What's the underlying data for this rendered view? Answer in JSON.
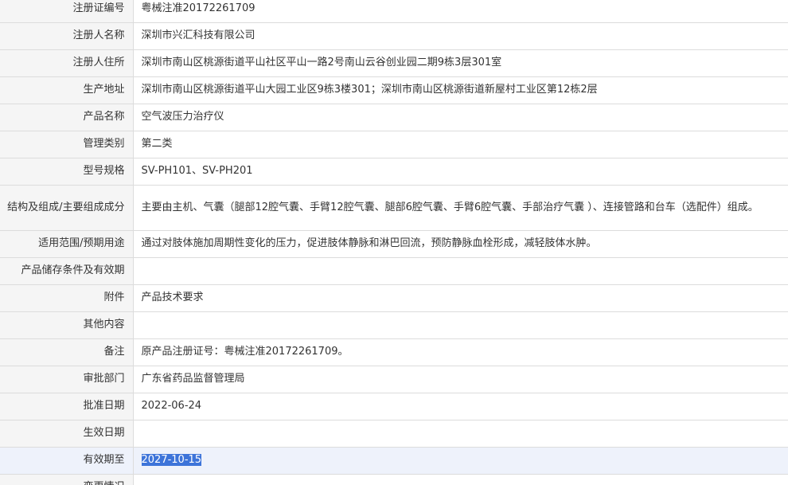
{
  "rows": [
    {
      "label": "注册证编号",
      "value": "粤械注准20172261709"
    },
    {
      "label": "注册人名称",
      "value": "深圳市兴汇科技有限公司"
    },
    {
      "label": "注册人住所",
      "value": "深圳市南山区桃源街道平山社区平山一路2号南山云谷创业园二期9栋3层301室"
    },
    {
      "label": "生产地址",
      "value": "深圳市南山区桃源街道平山大园工业区9栋3楼301；深圳市南山区桃源街道新屋村工业区第12栋2层"
    },
    {
      "label": "产品名称",
      "value": "空气波压力治疗仪"
    },
    {
      "label": "管理类别",
      "value": "第二类"
    },
    {
      "label": "型号规格",
      "value": "SV-PH101、SV-PH201"
    },
    {
      "label": "结构及组成/主要组成成分",
      "value": "主要由主机、气囊（腿部12腔气囊、手臂12腔气囊、腿部6腔气囊、手臂6腔气囊、手部治疗气囊 ）、连接管路和台车（选配件）组成。"
    },
    {
      "label": "适用范围/预期用途",
      "value": "通过对肢体施加周期性变化的压力，促进肢体静脉和淋巴回流，预防静脉血栓形成，减轻肢体水肿。"
    },
    {
      "label": "产品储存条件及有效期",
      "value": ""
    },
    {
      "label": "附件",
      "value": "产品技术要求"
    },
    {
      "label": "其他内容",
      "value": ""
    },
    {
      "label": "备注",
      "value": "原产品注册证号：粤械注准20172261709。"
    },
    {
      "label": "审批部门",
      "value": "广东省药品监督管理局"
    },
    {
      "label": "批准日期",
      "value": "2022-06-24"
    },
    {
      "label": "生效日期",
      "value": ""
    },
    {
      "label": "有效期至",
      "value": "2027-10-15"
    },
    {
      "label": "变更情况",
      "value": ""
    }
  ]
}
